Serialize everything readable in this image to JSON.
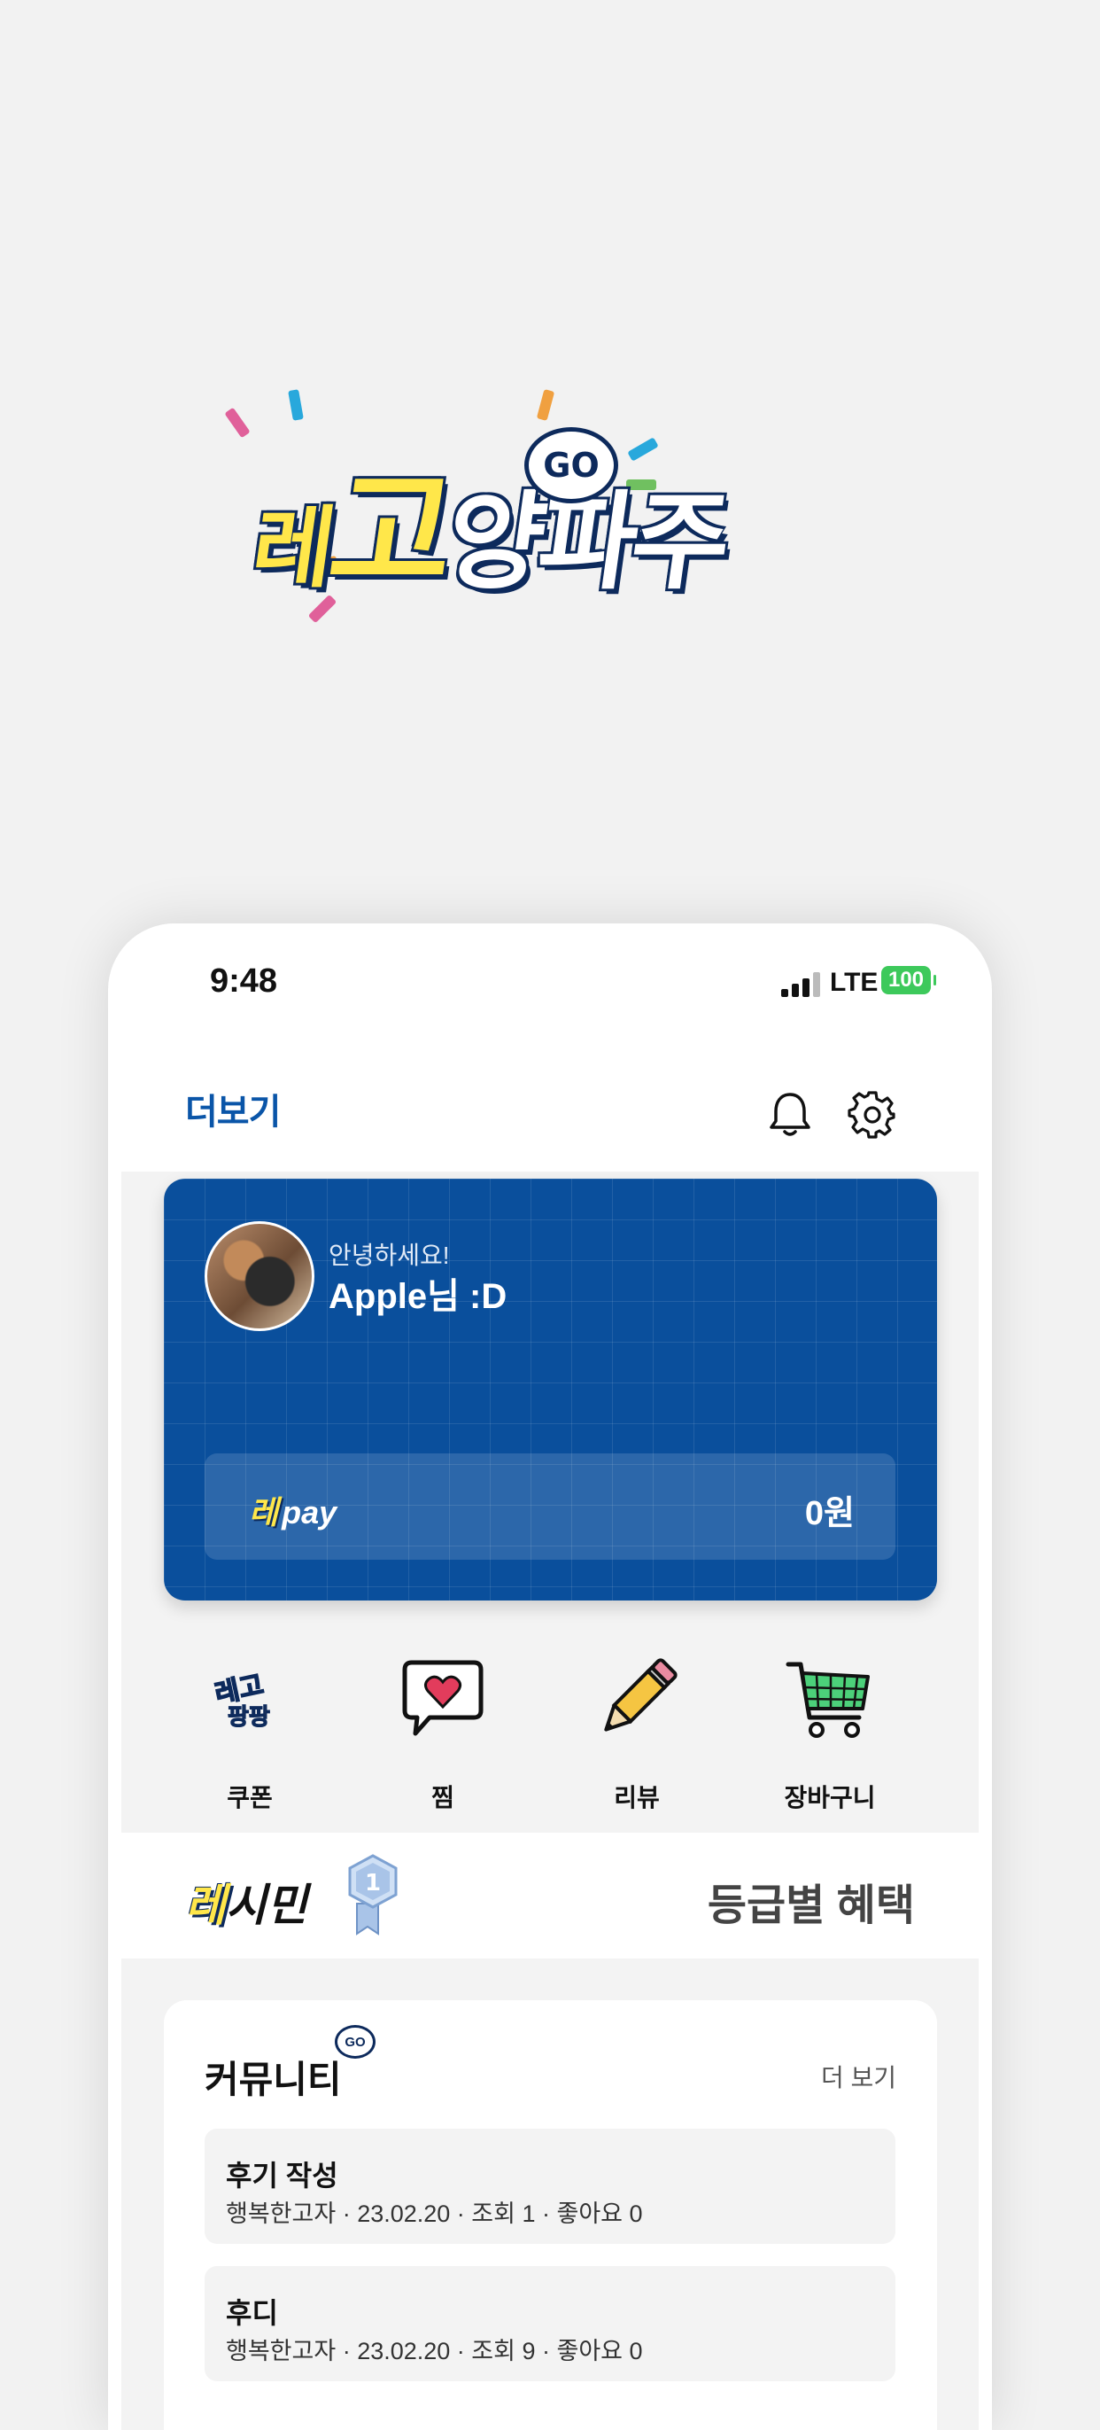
{
  "logo": {
    "text_a": "레",
    "text_b": "고",
    "text_c": "양파주",
    "bubble": "GO"
  },
  "status": {
    "time": "9:48",
    "network": "LTE",
    "battery": "100"
  },
  "header": {
    "title": "더보기"
  },
  "profile": {
    "greeting": "안녕하세요!",
    "name": "Apple님 :D"
  },
  "pay": {
    "mark": "레",
    "label": "pay",
    "amount": "0원"
  },
  "quick_menu": [
    {
      "label": "쿠폰",
      "icon": "coupon-icon"
    },
    {
      "label": "찜",
      "icon": "heart-speech-icon"
    },
    {
      "label": "리뷰",
      "icon": "pencil-icon"
    },
    {
      "label": "장바구니",
      "icon": "cart-icon"
    }
  ],
  "grade": {
    "mark": "레",
    "label": "시민",
    "level": "1",
    "benefits": "등급별 혜택"
  },
  "community": {
    "title": "커뮤니티",
    "bubble": "GO",
    "more": "더 보기",
    "posts": [
      {
        "title": "후기 작성",
        "meta": "행복한고자 · 23.02.20 · 조회 1 · 좋아요 0"
      },
      {
        "title": "후디",
        "meta": "행복한고자 · 23.02.20 · 조회 9 · 좋아요 0"
      }
    ]
  },
  "colors": {
    "brand_blue": "#0a4f9c",
    "accent_yellow": "#ffe74a",
    "battery_green": "#3dc95b"
  }
}
